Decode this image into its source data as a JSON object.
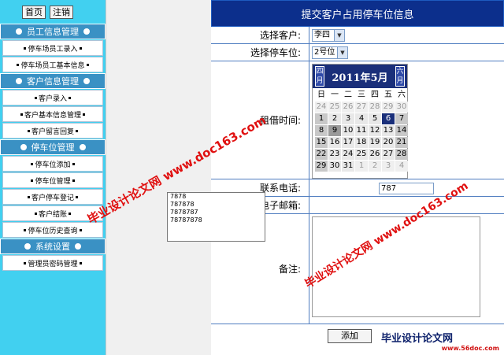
{
  "sidebar": {
    "buttons": [
      "首页",
      "注销"
    ],
    "sections": [
      {
        "title": "员工信息管理",
        "items": [
          "停车场员工录入",
          "停车场员工基本信息"
        ]
      },
      {
        "title": "客户信息管理",
        "items": [
          "客户录入",
          "客户基本信息管理",
          "客户留言回复"
        ]
      },
      {
        "title": "停车位管理",
        "items": [
          "停车位添加",
          "停车位管理",
          "客户停车登记",
          "客户结账",
          "停车位历史查询"
        ]
      },
      {
        "title": "系统设置",
        "items": [
          "管理员密码管理"
        ]
      }
    ]
  },
  "form": {
    "header": "提交客户占用停车位信息",
    "customer_label": "选择客户:",
    "customer_value": "李四",
    "space_label": "选择停车位:",
    "space_value": "2号位",
    "rent_label": "租借时间:",
    "phone_label": "联系电话:",
    "phone_value": "787",
    "email_label": "电子邮箱:",
    "note_label": "备注:",
    "submit_label": "添加"
  },
  "calendar": {
    "title": "2011年5月",
    "prev": "四月",
    "next": "六月",
    "weekdays": [
      "日",
      "一",
      "二",
      "三",
      "四",
      "五",
      "六"
    ],
    "weeks": [
      [
        "24",
        "25",
        "26",
        "27",
        "28",
        "29",
        "30"
      ],
      [
        "1",
        "2",
        "3",
        "4",
        "5",
        "6",
        "7"
      ],
      [
        "8",
        "9",
        "10",
        "11",
        "12",
        "13",
        "14"
      ],
      [
        "15",
        "16",
        "17",
        "18",
        "19",
        "20",
        "21"
      ],
      [
        "22",
        "23",
        "24",
        "25",
        "26",
        "27",
        "28"
      ],
      [
        "29",
        "30",
        "31",
        "1",
        "2",
        "3",
        "4"
      ]
    ],
    "selected_day": "6",
    "today_day": "9"
  },
  "autocomplete": [
    "7878",
    "787878",
    "7878787",
    "78787878"
  ],
  "watermarks": {
    "text1": "毕业设计论文网 www.doc163.com",
    "text2": "毕业设计论文网 www.doc163.com",
    "logo": "毕业设计论文网",
    "logo_url": "www.56doc.com"
  },
  "colors": {
    "sidebar": "#41d0f0",
    "section": "#3a91c4",
    "header": "#0c2f8c",
    "accent": "#1a2f7a"
  }
}
